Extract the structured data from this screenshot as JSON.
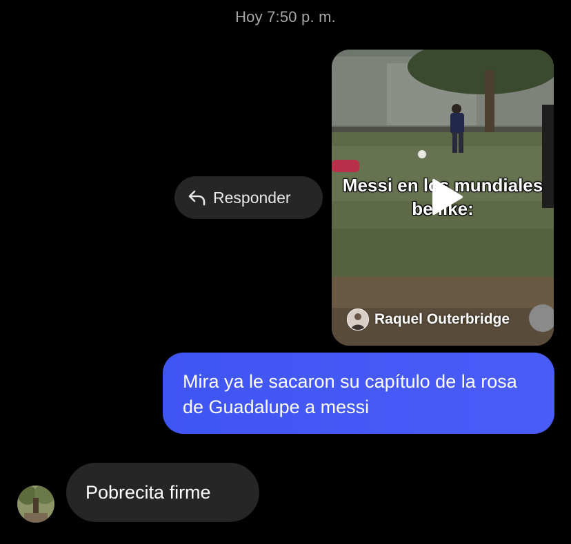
{
  "thread": {
    "timestamp": "Hoy 7:50 p. m."
  },
  "reply_action": {
    "label": "Responder",
    "icon": "reply-arrow-icon"
  },
  "shared_video": {
    "caption_line1": "Messi en los mundiales",
    "caption_line2": "be like:",
    "creator_name": "Raquel Outerbridge",
    "play_icon": "play-icon"
  },
  "messages": [
    {
      "direction": "sent",
      "text": "Mira ya le sacaron su capítulo de la rosa de Guadalupe a messi"
    },
    {
      "direction": "received",
      "text": "Pobrecita firme"
    }
  ],
  "colors": {
    "background": "#000000",
    "sent_bubble": "#4356f5",
    "received_bubble": "#262626",
    "reply_pill": "#262626",
    "timestamp_text": "#a8a8a8"
  }
}
